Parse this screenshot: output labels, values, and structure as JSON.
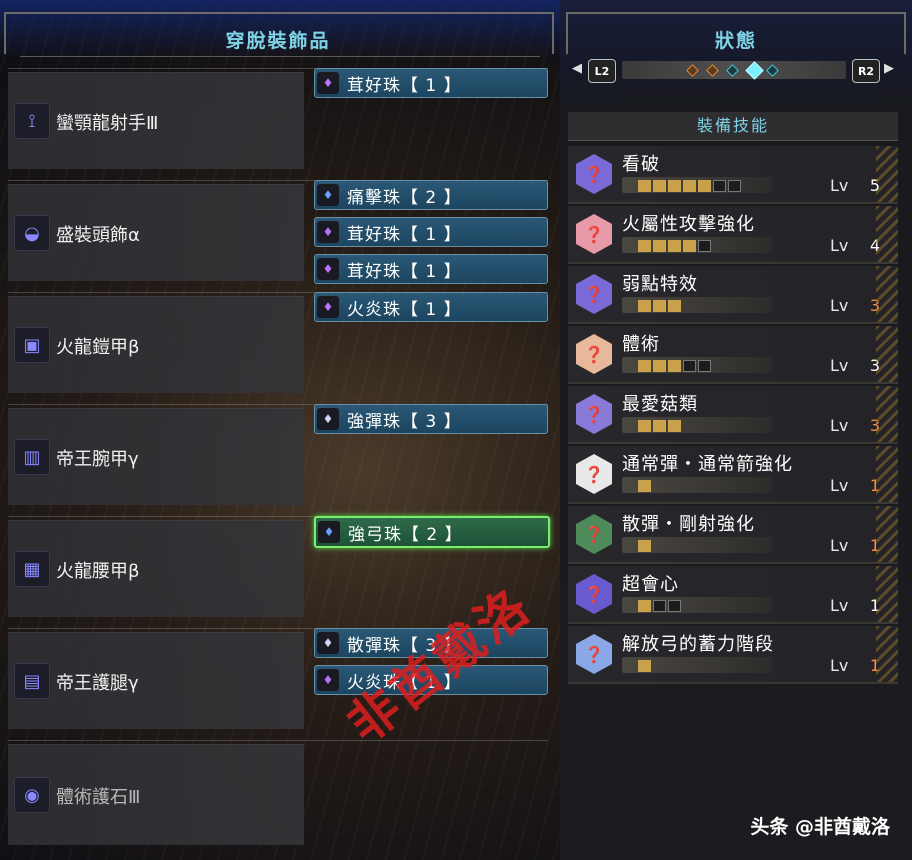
{
  "left_panel": {
    "title": "穿脫裝飾品",
    "equipment": [
      {
        "name": "蠻顎龍射手Ⅲ",
        "icon": "bow-icon",
        "decorations": [
          {
            "label": "茸好珠【 1 】",
            "icon": "jewel-slot-1-icon"
          }
        ]
      },
      {
        "name": "盛裝頭飾α",
        "icon": "helmet-icon",
        "decorations": [
          {
            "label": "痛擊珠【 2 】",
            "icon": "jewel-slot-2-icon"
          },
          {
            "label": "茸好珠【 1 】",
            "icon": "jewel-slot-1-icon"
          },
          {
            "label": "茸好珠【 1 】",
            "icon": "jewel-slot-1-icon"
          }
        ]
      },
      {
        "name": "火龍鎧甲β",
        "icon": "chest-armor-icon",
        "decorations": [
          {
            "label": "火炎珠【 1 】",
            "icon": "jewel-slot-1-icon"
          }
        ]
      },
      {
        "name": "帝王腕甲γ",
        "icon": "arm-armor-icon",
        "decorations": [
          {
            "label": "強彈珠【 3 】",
            "icon": "jewel-slot-3-icon"
          }
        ]
      },
      {
        "name": "火龍腰甲β",
        "icon": "waist-armor-icon",
        "decorations": [
          {
            "label": "強弓珠【 2 】",
            "icon": "jewel-slot-2-icon",
            "selected": true
          }
        ]
      },
      {
        "name": "帝王護腿γ",
        "icon": "leg-armor-icon",
        "decorations": [
          {
            "label": "散彈珠【 3 】",
            "icon": "jewel-slot-3-icon"
          },
          {
            "label": "火炎珠【 1 】",
            "icon": "jewel-slot-1-icon"
          }
        ]
      },
      {
        "name": "體術護石Ⅲ",
        "icon": "charm-icon",
        "decorations": []
      }
    ]
  },
  "right_panel": {
    "title": "狀態",
    "nav": {
      "left_button": "L2",
      "right_button": "R2",
      "left_arrow": "◀",
      "right_arrow": "▶",
      "pages": 5,
      "active_page": 4
    },
    "skills_header": "裝備技能",
    "lv_label": "Lv",
    "skills": [
      {
        "name": "看破",
        "level": 5,
        "max": 7,
        "color": "#7a6ad8",
        "level_color": "#ffffff"
      },
      {
        "name": "火屬性攻擊強化",
        "level": 4,
        "max": 5,
        "color": "#e89aa8",
        "level_color": "#ffffff"
      },
      {
        "name": "弱點特效",
        "level": 3,
        "max": 3,
        "color": "#7a6ad8",
        "level_color": "#ff8a3a"
      },
      {
        "name": "體術",
        "level": 3,
        "max": 5,
        "color": "#e8b89a",
        "level_color": "#ffffff"
      },
      {
        "name": "最愛菇類",
        "level": 3,
        "max": 3,
        "color": "#8a7ad8",
        "level_color": "#ff8a3a"
      },
      {
        "name": "通常彈・通常箭強化",
        "level": 1,
        "max": 1,
        "color": "#e8e8e8",
        "level_color": "#ff8a3a"
      },
      {
        "name": "散彈・剛射強化",
        "level": 1,
        "max": 1,
        "color": "#4e8a5a",
        "level_color": "#ff8a3a"
      },
      {
        "name": "超會心",
        "level": 1,
        "max": 3,
        "color": "#6a5ad0",
        "level_color": "#ffffff"
      },
      {
        "name": "解放弓的蓄力階段",
        "level": 1,
        "max": 1,
        "color": "#8aa8e8",
        "level_color": "#ff8a3a"
      }
    ]
  },
  "watermark": "非酋戴洛",
  "credit": "头条 @非酋戴洛"
}
